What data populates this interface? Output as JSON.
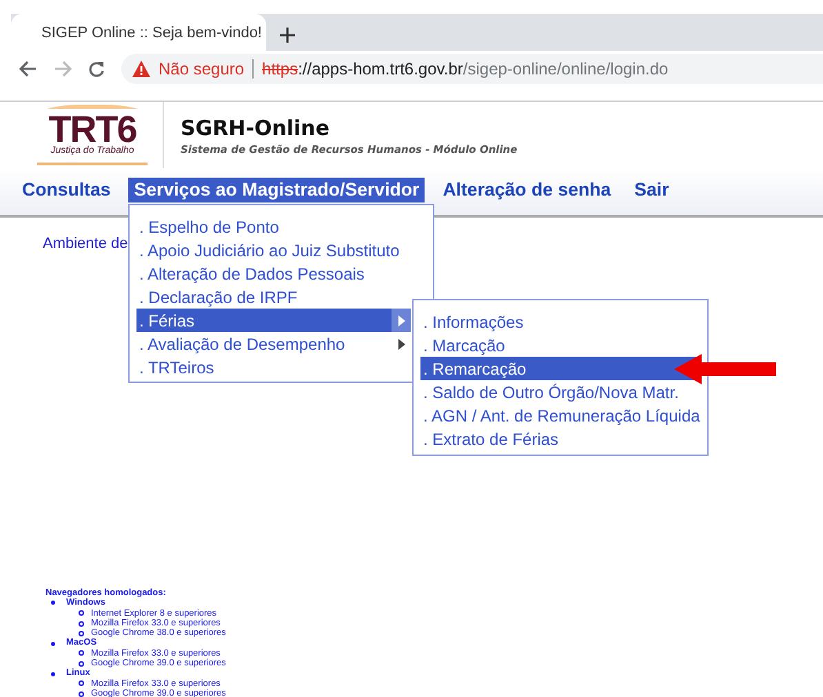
{
  "browser": {
    "tab_title": "SIGEP Online :: Seja bem-vindo!",
    "security": "Não seguro",
    "url": {
      "scheme": "https",
      "host": "://apps-hom.trt6.gov.br",
      "path": "/sigep-online/online/login.do"
    }
  },
  "header": {
    "logo": {
      "text": "TRT6",
      "subtitle": "Justiça do Trabalho"
    },
    "title": "SGRH-Online",
    "subtitle": "Sistema de Gestão de Recursos Humanos - Módulo Online"
  },
  "nav": [
    {
      "label": "Consultas",
      "selected": false
    },
    {
      "label": "Serviços ao Magistrado/Servidor",
      "selected": true
    },
    {
      "label": "Alteração de senha",
      "selected": false
    },
    {
      "label": "Sair",
      "selected": false
    }
  ],
  "environment_text": "Ambiente de",
  "menu": [
    {
      "label": ". Espelho de Ponto",
      "selected": false,
      "has_submenu": false
    },
    {
      "label": ". Apoio Judiciário ao Juiz Substituto",
      "selected": false,
      "has_submenu": false
    },
    {
      "label": ". Alteração de Dados Pessoais",
      "selected": false,
      "has_submenu": false
    },
    {
      "label": ". Declaração de IRPF",
      "selected": false,
      "has_submenu": false
    },
    {
      "label": ". Férias",
      "selected": true,
      "has_submenu": true
    },
    {
      "label": ". Avaliação de Desempenho",
      "selected": false,
      "has_submenu": true
    },
    {
      "label": ". TRTeiros",
      "selected": false,
      "has_submenu": false
    }
  ],
  "submenu": [
    {
      "label": ". Informações",
      "selected": false
    },
    {
      "label": ". Marcação",
      "selected": false
    },
    {
      "label": ". Remarcação",
      "selected": true
    },
    {
      "label": ". Saldo de Outro Órgão/Nova Matr.",
      "selected": false
    },
    {
      "label": ". AGN / Ant. de Remuneração Líquida",
      "selected": false
    },
    {
      "label": ". Extrato de Férias",
      "selected": false
    }
  ],
  "browsers": {
    "title": "Navegadores homologados:",
    "groups": [
      {
        "name": "Windows",
        "items": [
          "Internet Explorer 8 e superiores",
          "Mozilla Firefox 33.0 e superiores",
          "Google Chrome 38.0 e superiores"
        ]
      },
      {
        "name": "MacOS",
        "items": [
          "Mozilla Firefox 33.0 e superiores",
          "Google Chrome 39.0 e superiores"
        ]
      },
      {
        "name": "Linux",
        "items": [
          "Mozilla Firefox 33.0 e superiores",
          "Google Chrome 39.0 e superiores"
        ]
      }
    ]
  }
}
